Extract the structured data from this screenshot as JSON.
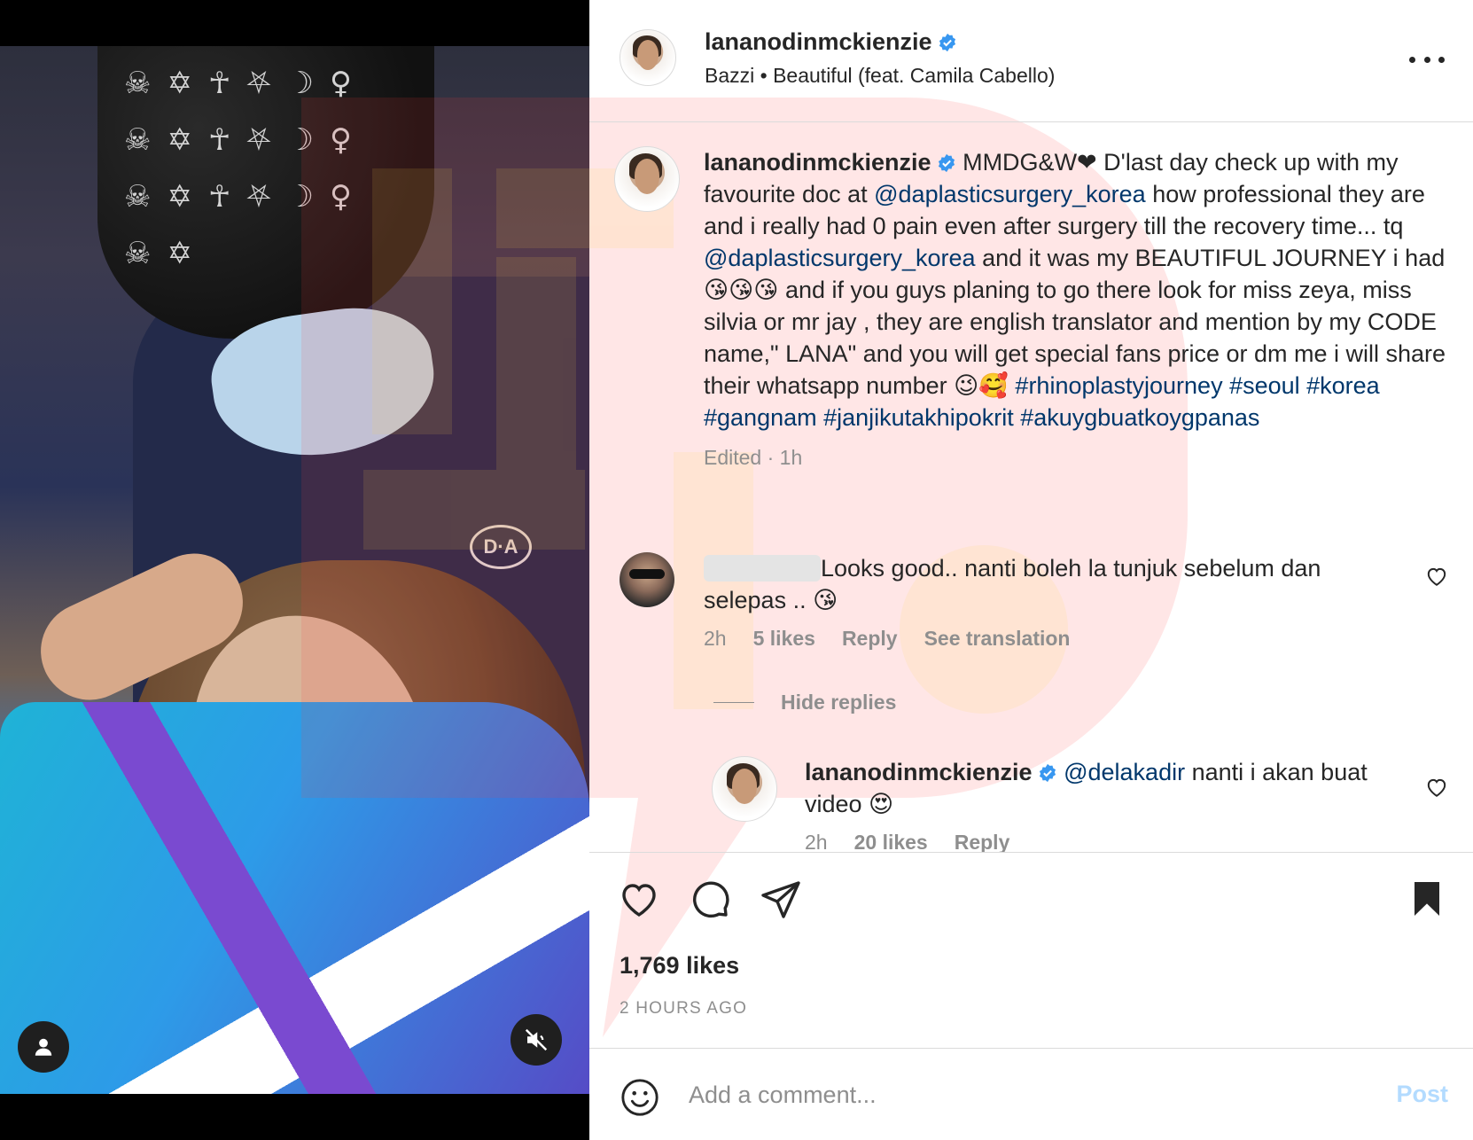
{
  "post": {
    "username": "lananodinmckienzie",
    "verified": true,
    "audio_artist": "Bazzi",
    "audio_separator": "•",
    "audio_title": "Beautiful (feat. Camila Cabello)"
  },
  "caption": {
    "username": "lananodinmckienzie",
    "segments": [
      {
        "type": "text",
        "value": " MMDG&W❤ D'last day check up with my favourite doc at "
      },
      {
        "type": "link",
        "value": "@daplasticsurgery_korea"
      },
      {
        "type": "text",
        "value": " how professional they are and i really had 0 pain even after surgery till the recovery time... tq "
      },
      {
        "type": "link",
        "value": "@daplasticsurgery_korea"
      },
      {
        "type": "text",
        "value": " and it was my BEAUTIFUL JOURNEY i had 😘😘😘 and if you guys planing to go there look for miss zeya, miss silvia or mr jay , they are english translator and mention by my CODE name,\" LANA\" and you will get special fans price or dm me i will share their whatsapp number 😉🥰 "
      },
      {
        "type": "link",
        "value": "#rhinoplastyjourney #seoul #korea #gangnam #janjikutakhipokrit #akuygbuatkoygpanas"
      }
    ],
    "meta": "Edited · 1h"
  },
  "comment": {
    "text": "Looks good.. nanti boleh la tunjuk sebelum dan selepas .. 😘",
    "time": "2h",
    "likes": "5 likes",
    "reply_label": "Reply",
    "translate_label": "See translation"
  },
  "hide_replies_label": "Hide replies",
  "reply": {
    "username": "lananodinmckienzie",
    "mention": "@delakadir",
    "text": " nanti i akan buat video 😍",
    "time": "2h",
    "likes": "20 likes",
    "reply_label": "Reply"
  },
  "actions": {
    "likes": "1,769 likes",
    "time_ago": "2 HOURS AGO"
  },
  "add_comment": {
    "placeholder": "Add a comment...",
    "post_label": "Post"
  },
  "media": {
    "cap_symbols": "☠✡☥⛧☽♀☠✡☥⛧☽♀☠✡☥⛧☽♀☠✡",
    "badge": "D·A"
  },
  "colors": {
    "verified_blue": "#3897f0",
    "link_blue": "#00376b",
    "muted_gray": "#8e8e8e",
    "post_disabled": "#b3dbff"
  }
}
